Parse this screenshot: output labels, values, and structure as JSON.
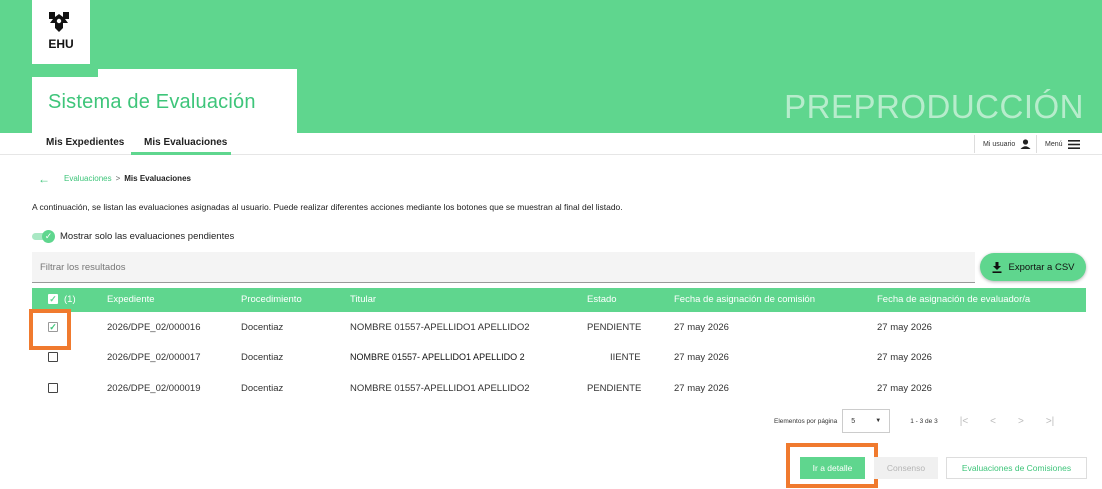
{
  "colors": {
    "brand_green": "#5fd68e",
    "highlight_orange": "#f07a2e"
  },
  "header": {
    "logo_text": "EHU",
    "app_title": "Sistema de Evaluación",
    "environment": "PREPRODUCCIÓN"
  },
  "nav": {
    "tabs": [
      {
        "label": "Mis Expedientes",
        "active": false
      },
      {
        "label": "Mis Evaluaciones",
        "active": true
      }
    ],
    "user_label": "Mi usuario",
    "user_icon": "person-icon",
    "menu_label": "Menú",
    "menu_icon": "hamburger-icon"
  },
  "breadcrumb": {
    "back_icon": "arrow-left-icon",
    "parent": "Evaluaciones",
    "separator": ">",
    "current": "Mis Evaluaciones"
  },
  "intro": "A continuación, se listan las evaluaciones asignadas al usuario. Puede realizar diferentes acciones mediante los botones que se muestran al final del listado.",
  "toggle": {
    "label": "Mostrar solo las evaluaciones pendientes",
    "on": true
  },
  "filter": {
    "placeholder": "Filtrar los resultados"
  },
  "export_button": {
    "label": "Exportar a CSV",
    "icon": "download-icon"
  },
  "table": {
    "selected_count": "(1)",
    "columns": [
      "Expediente",
      "Procedimiento",
      "Titular",
      "Estado",
      "Fecha de asignación de comisión",
      "Fecha de asignación de evaluador/a"
    ],
    "rows": [
      {
        "checked": true,
        "expediente": "2026/DPE_02/000016",
        "procedimiento": "Docentiaz",
        "titular": "NOMBRE 01557-APELLIDO1 APELLIDO2",
        "estado": "PENDIENTE",
        "fecha_comision": "27 may 2026",
        "fecha_evaluador": "27 may 2026"
      },
      {
        "checked": false,
        "expediente": "2026/DPE_02/000017",
        "procedimiento": "Docentiaz",
        "titular": "NOMBRE 01557- APELLIDO1 APELLIDO 2",
        "estado": "IIENTE",
        "fecha_comision": "27 may 2026",
        "fecha_evaluador": "27 may 2026"
      },
      {
        "checked": false,
        "expediente": "2026/DPE_02/000019",
        "procedimiento": "Docentiaz",
        "titular": "NOMBRE 01557-APELLIDO1 APELLIDO2",
        "estado": "PENDIENTE",
        "fecha_comision": "27 may 2026",
        "fecha_evaluador": "27 may 2026"
      }
    ]
  },
  "pagination": {
    "label": "Elementos por página",
    "page_size": "5",
    "range": "1 - 3 de 3",
    "first": "|<",
    "prev": "<",
    "next": ">",
    "last": ">|"
  },
  "actions": {
    "detail": "Ir a detalle",
    "consenso": "Consenso",
    "comisiones": "Evaluaciones de Comisiones"
  }
}
